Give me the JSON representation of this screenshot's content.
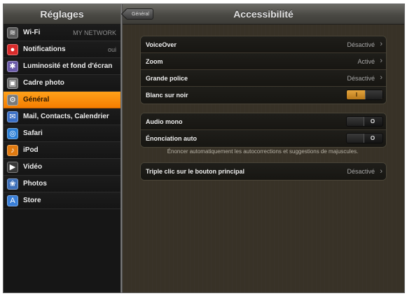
{
  "sidebar": {
    "title": "Réglages",
    "items": [
      {
        "label": "Wi-Fi",
        "value": "MY NETWORK",
        "icon": "wifi-icon",
        "color": "#5a5a5a",
        "glyph": "≋"
      },
      {
        "label": "Notifications",
        "value": "oui",
        "icon": "notifications-icon",
        "color": "#d92b2b",
        "glyph": "●"
      },
      {
        "label": "Luminosité et fond d'écran",
        "value": "",
        "icon": "brightness-icon",
        "color": "#6a5aa8",
        "glyph": "✱"
      },
      {
        "label": "Cadre photo",
        "value": "",
        "icon": "picture-frame-icon",
        "color": "#6a6a6a",
        "glyph": "▣"
      },
      {
        "label": "Général",
        "value": "",
        "icon": "gear-icon",
        "color": "#7a7a7a",
        "glyph": "⚙"
      },
      {
        "label": "Mail, Contacts, Calendrier",
        "value": "",
        "icon": "mail-icon",
        "color": "#3a6fc6",
        "glyph": "✉"
      },
      {
        "label": "Safari",
        "value": "",
        "icon": "safari-icon",
        "color": "#2b7fd6",
        "glyph": "◎"
      },
      {
        "label": "iPod",
        "value": "",
        "icon": "ipod-icon",
        "color": "#e07a10",
        "glyph": "♪"
      },
      {
        "label": "Vidéo",
        "value": "",
        "icon": "video-icon",
        "color": "#3a3a3a",
        "glyph": "▶"
      },
      {
        "label": "Photos",
        "value": "",
        "icon": "photos-icon",
        "color": "#3d6fb8",
        "glyph": "❀"
      },
      {
        "label": "Store",
        "value": "",
        "icon": "store-icon",
        "color": "#3a7fd8",
        "glyph": "A"
      }
    ],
    "selected_index": 4
  },
  "header": {
    "title": "Accessibilité",
    "back_label": "Général"
  },
  "groups": [
    {
      "cells": [
        {
          "label": "VoiceOver",
          "value": "Désactivé",
          "chevron": "›"
        },
        {
          "label": "Zoom",
          "value": "Activé",
          "chevron": "›"
        },
        {
          "label": "Grande police",
          "value": "Désactivé",
          "chevron": "›"
        },
        {
          "label": "Blanc sur noir",
          "toggle": "I",
          "toggle_on": true
        }
      ]
    },
    {
      "cells": [
        {
          "label": "Audio mono",
          "toggle": "O",
          "toggle_on": false
        },
        {
          "label": "Énonciation auto",
          "toggle": "O",
          "toggle_on": false
        }
      ],
      "footnote": "Énoncer automatiquement les autocorrections et suggestions de majuscules."
    },
    {
      "cells": [
        {
          "label": "Triple clic sur le bouton principal",
          "value": "Désactivé",
          "chevron": "›"
        }
      ]
    }
  ],
  "colors": {
    "selected": "#f88a08",
    "toggle_on": "#d89530"
  }
}
